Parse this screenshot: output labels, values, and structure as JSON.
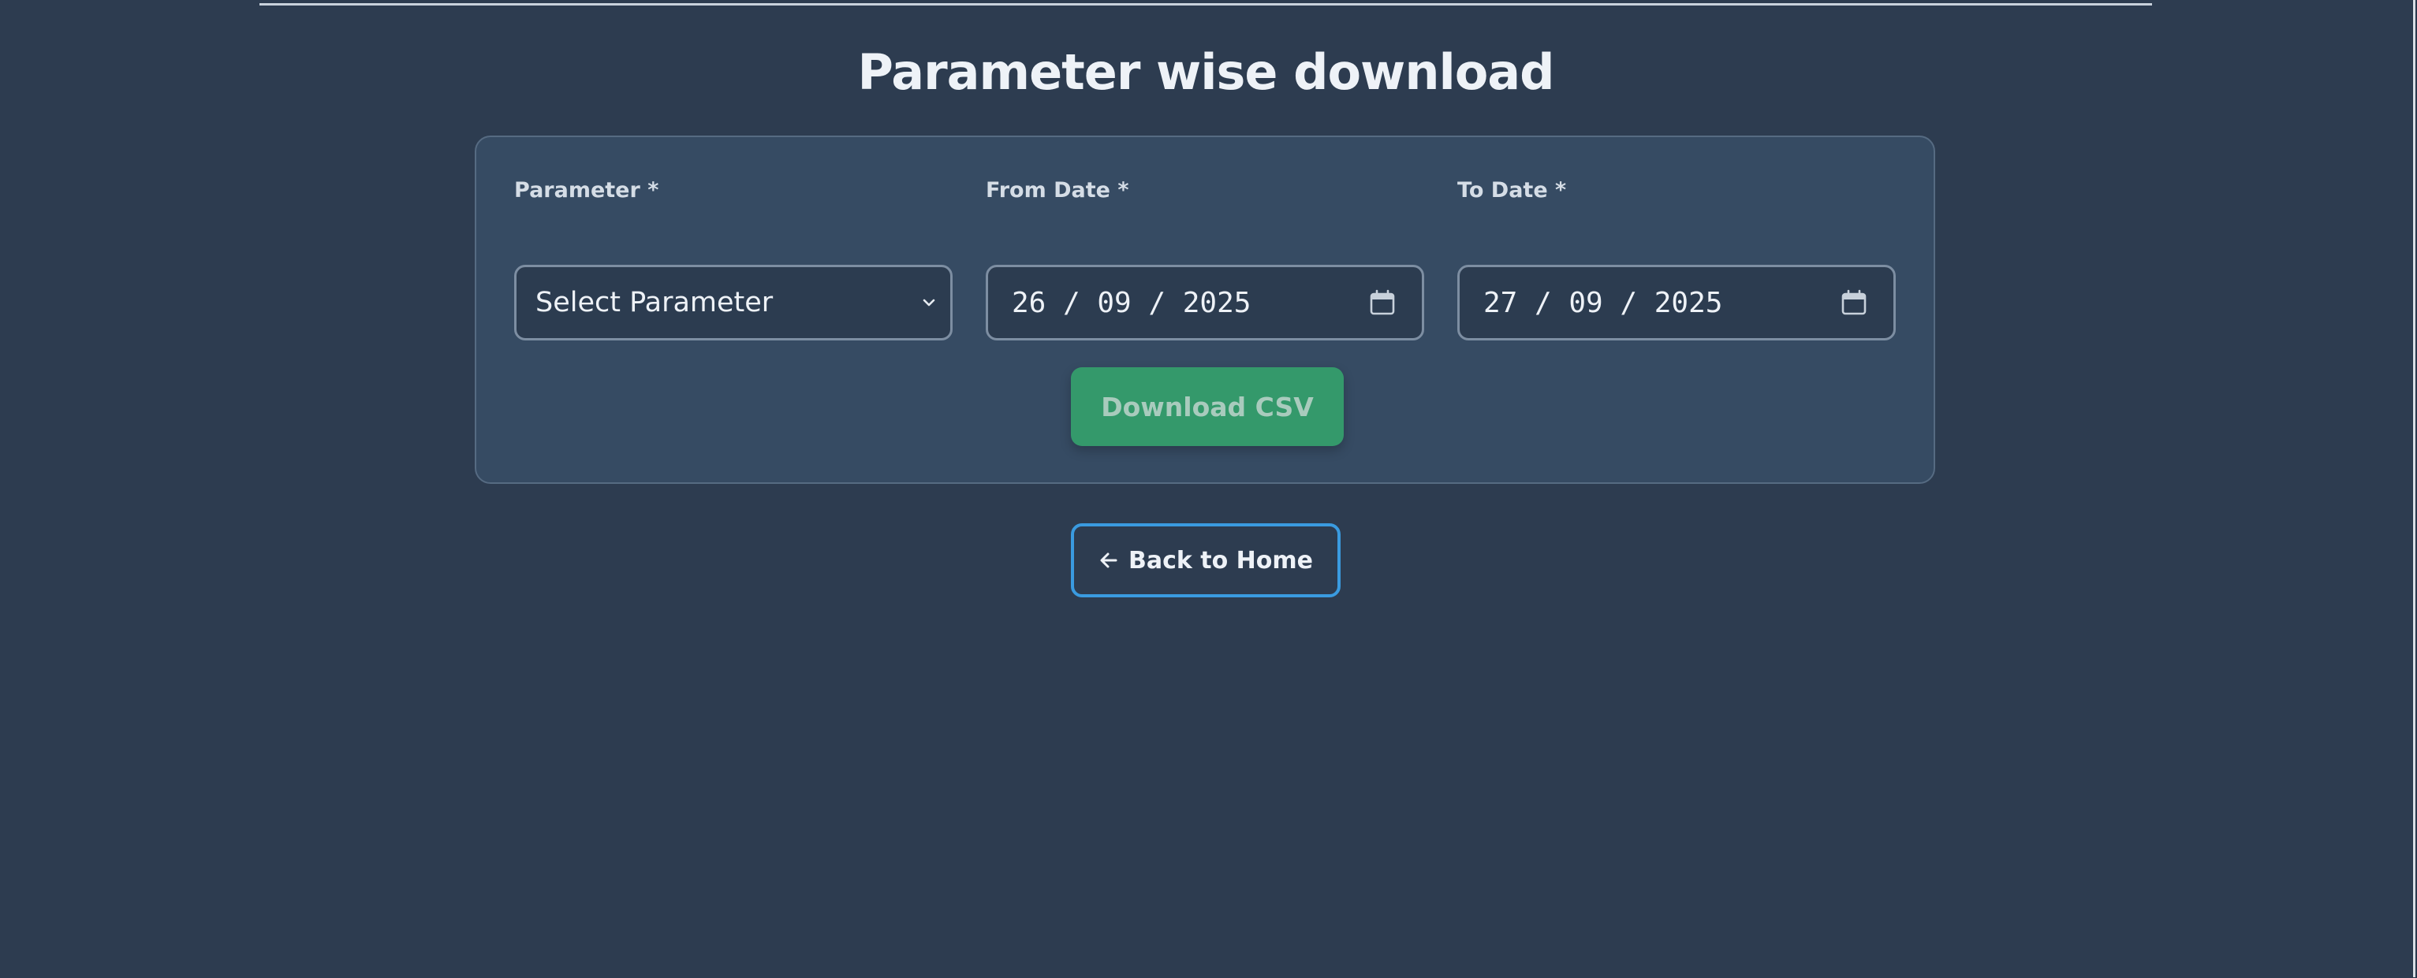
{
  "page": {
    "title": "Parameter wise download"
  },
  "form": {
    "parameter": {
      "label": "Parameter *",
      "value": "Select Parameter",
      "icon": "chevron-down-icon"
    },
    "from_date": {
      "label": "From Date *",
      "value": "26 / 09 / 2025",
      "icon": "calendar-icon"
    },
    "to_date": {
      "label": "To Date *",
      "value": "27 / 09 / 2025",
      "icon": "calendar-icon"
    },
    "download_label": "Download CSV"
  },
  "nav": {
    "back_label": "Back to Home",
    "back_icon": "arrow-left-icon"
  },
  "colors": {
    "background": "#2d3c50",
    "card": "#364b63",
    "download_button": "#34996b",
    "back_button_border": "#3a9be0"
  }
}
